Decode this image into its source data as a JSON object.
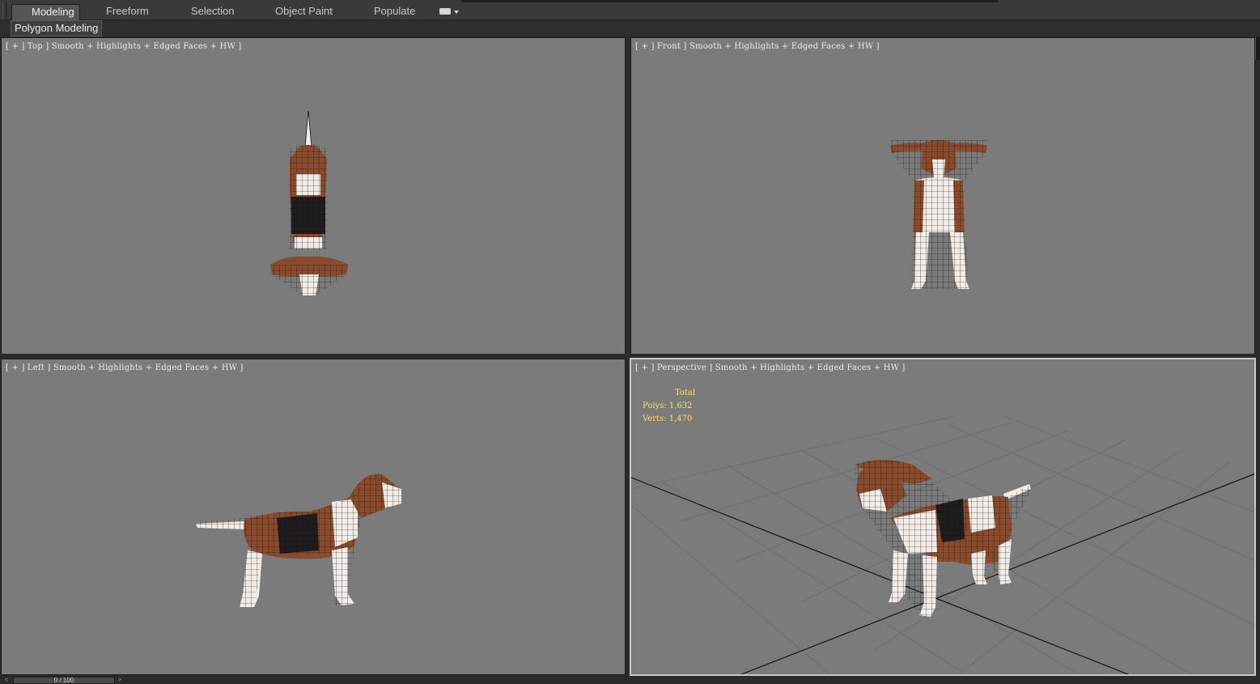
{
  "ribbon": {
    "tabs": [
      {
        "label": "Modeling",
        "active": true
      },
      {
        "label": "Freeform",
        "active": false
      },
      {
        "label": "Selection",
        "active": false
      },
      {
        "label": "Object Paint",
        "active": false
      },
      {
        "label": "Populate",
        "active": false
      }
    ],
    "panel_label": "Polygon Modeling"
  },
  "viewports": {
    "top": {
      "label": "[ + ] Top ] Smooth + Highlights + Edged Faces + HW ]"
    },
    "front": {
      "label": "[ + ] Front ] Smooth + Highlights + Edged Faces + HW ]"
    },
    "left": {
      "label": "[ + ] Left ] Smooth + Highlights + Edged Faces + HW ]"
    },
    "perspective": {
      "label": "[ + ] Perspective ] Smooth + Highlights + Edged Faces + HW ]"
    }
  },
  "stats": {
    "total": "Total",
    "polys": "Polys: 1,632",
    "verts": "Verts: 1,470"
  },
  "timeline": {
    "frame": "0 / 100",
    "prev": "<",
    "next": ">"
  },
  "colors": {
    "viewport_bg": "#7b7b7b",
    "stats_text": "#ffe14a",
    "fur_brown": "#8a4a2c",
    "fur_white": "#f2ece8",
    "fur_black": "#1e1c1c",
    "wire": "#101010"
  }
}
